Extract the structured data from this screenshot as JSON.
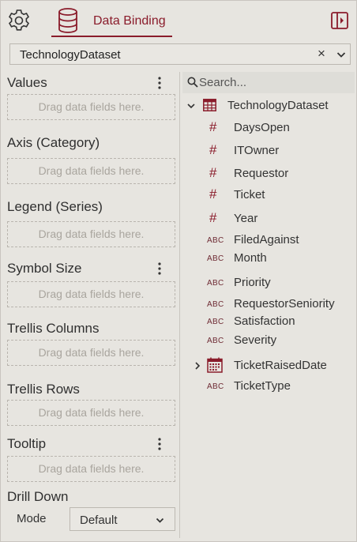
{
  "header": {
    "settings_icon": "gear-icon",
    "tab_label": "Data Binding",
    "tab_icon": "database-icon",
    "collapse_icon": "panel-collapse-icon",
    "accent": "#8a1c2b"
  },
  "dataset_select": {
    "value": "TechnologyDataset",
    "clear_symbol": "×"
  },
  "bindings": {
    "drop_placeholder": "Drag data fields here.",
    "sections": [
      {
        "label": "Values",
        "has_menu": true
      },
      {
        "label": "Axis (Category)",
        "has_menu": false
      },
      {
        "label": "Legend (Series)",
        "has_menu": false
      },
      {
        "label": "Symbol Size",
        "has_menu": true
      },
      {
        "label": "Trellis Columns",
        "has_menu": false
      },
      {
        "label": "Trellis Rows",
        "has_menu": false
      },
      {
        "label": "Tooltip",
        "has_menu": true
      }
    ],
    "drill_down": {
      "label": "Drill Down",
      "mode_label": "Mode",
      "mode_value": "Default"
    }
  },
  "fields_panel": {
    "search_placeholder": "Search...",
    "root": {
      "label": "TechnologyDataset",
      "icon": "table-icon",
      "expanded": true
    },
    "fields": [
      {
        "label": "DaysOpen",
        "type": "numeric"
      },
      {
        "label": "ITOwner",
        "type": "numeric"
      },
      {
        "label": "Requestor",
        "type": "numeric"
      },
      {
        "label": "Ticket",
        "type": "numeric"
      },
      {
        "label": "Year",
        "type": "numeric"
      },
      {
        "label": "FiledAgainst",
        "type": "text"
      },
      {
        "label": "Month",
        "type": "text"
      },
      {
        "label": "Priority",
        "type": "text"
      },
      {
        "label": "RequestorSeniority",
        "type": "text"
      },
      {
        "label": "Satisfaction",
        "type": "text"
      },
      {
        "label": "Severity",
        "type": "text"
      },
      {
        "label": "TicketRaisedDate",
        "type": "date",
        "expandable": true
      },
      {
        "label": "TicketType",
        "type": "text"
      }
    ],
    "numeric_symbol": "#",
    "text_symbol": "ABC"
  }
}
